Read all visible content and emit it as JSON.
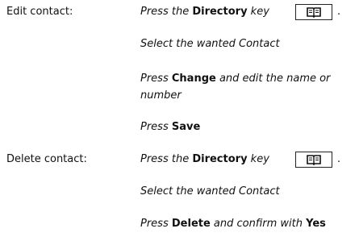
{
  "sections": [
    {
      "label": "Edit contact:",
      "steps": {
        "s1_pre": "Press the ",
        "s1_bold": "Directory",
        "s1_post": " key",
        "s1_period": ".",
        "s2": "Select the wanted Contact",
        "s3_pre": "Press ",
        "s3_bold": "Change",
        "s3_post": " and edit the name or number",
        "s4_pre": "Press ",
        "s4_bold": "Save"
      }
    },
    {
      "label": "Delete contact:",
      "steps": {
        "s1_pre": "Press the ",
        "s1_bold": "Directory",
        "s1_post": " key",
        "s1_period": ".",
        "s2": "Select the wanted Contact",
        "s3_pre": "Press ",
        "s3_bold": "Delete",
        "s3_mid": " and confirm with ",
        "s3_bold2": "Yes"
      }
    }
  ],
  "icons": {
    "directory_key": "book-icon"
  }
}
